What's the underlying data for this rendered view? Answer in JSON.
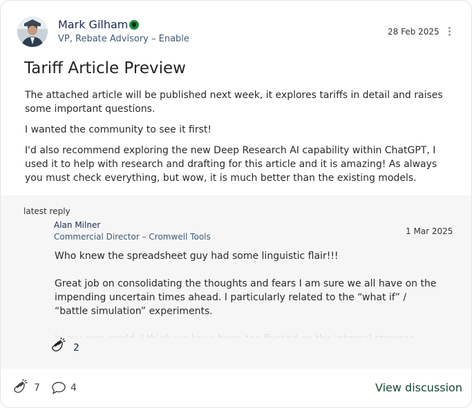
{
  "post": {
    "author_name": "Mark Gilham",
    "author_title": "VP, Rebate Advisory – Enable",
    "date": "28 Feb 2025",
    "title": "Tariff Article Preview",
    "paragraphs": [
      "The attached article will be published next week, it explores tariffs in detail and raises some important questions.",
      "I wanted the community to see it first!",
      "I'd also recommend exploring the new Deep Research AI capability within ChatGPT, I used it to help with research and drafting for this article and it is amazing! As always you must check everything, but wow, it is much better than the existing models."
    ],
    "verified_icon": "verified-shield-icon",
    "verified_color": "#1e8f3c"
  },
  "reply": {
    "label": "latest reply",
    "author_name": "Alan Milner",
    "author_title": "Commercial Director – Cromwell Tools",
    "date": "1 Mar 2025",
    "paragraphs": [
      "Who knew the spreadsheet guy had some linguistic flair!!!",
      "Great job on consolidating the thoughts and fears I am sure we all have on the impending uncertain times ahead. I particularly related to the “what if” / “battle simulation” experiments.",
      "In my own world, I think we have been too fixated on the internal stresses faced, be"
    ],
    "clap_count": "2",
    "clap_icon": "clap-icon"
  },
  "footer": {
    "clap_count": "7",
    "comment_count": "4",
    "view_label": "View discussion",
    "link_color": "#164a2c"
  },
  "colors": {
    "name_color": "#1c2a55",
    "reply_background": "#f6f6f6"
  }
}
